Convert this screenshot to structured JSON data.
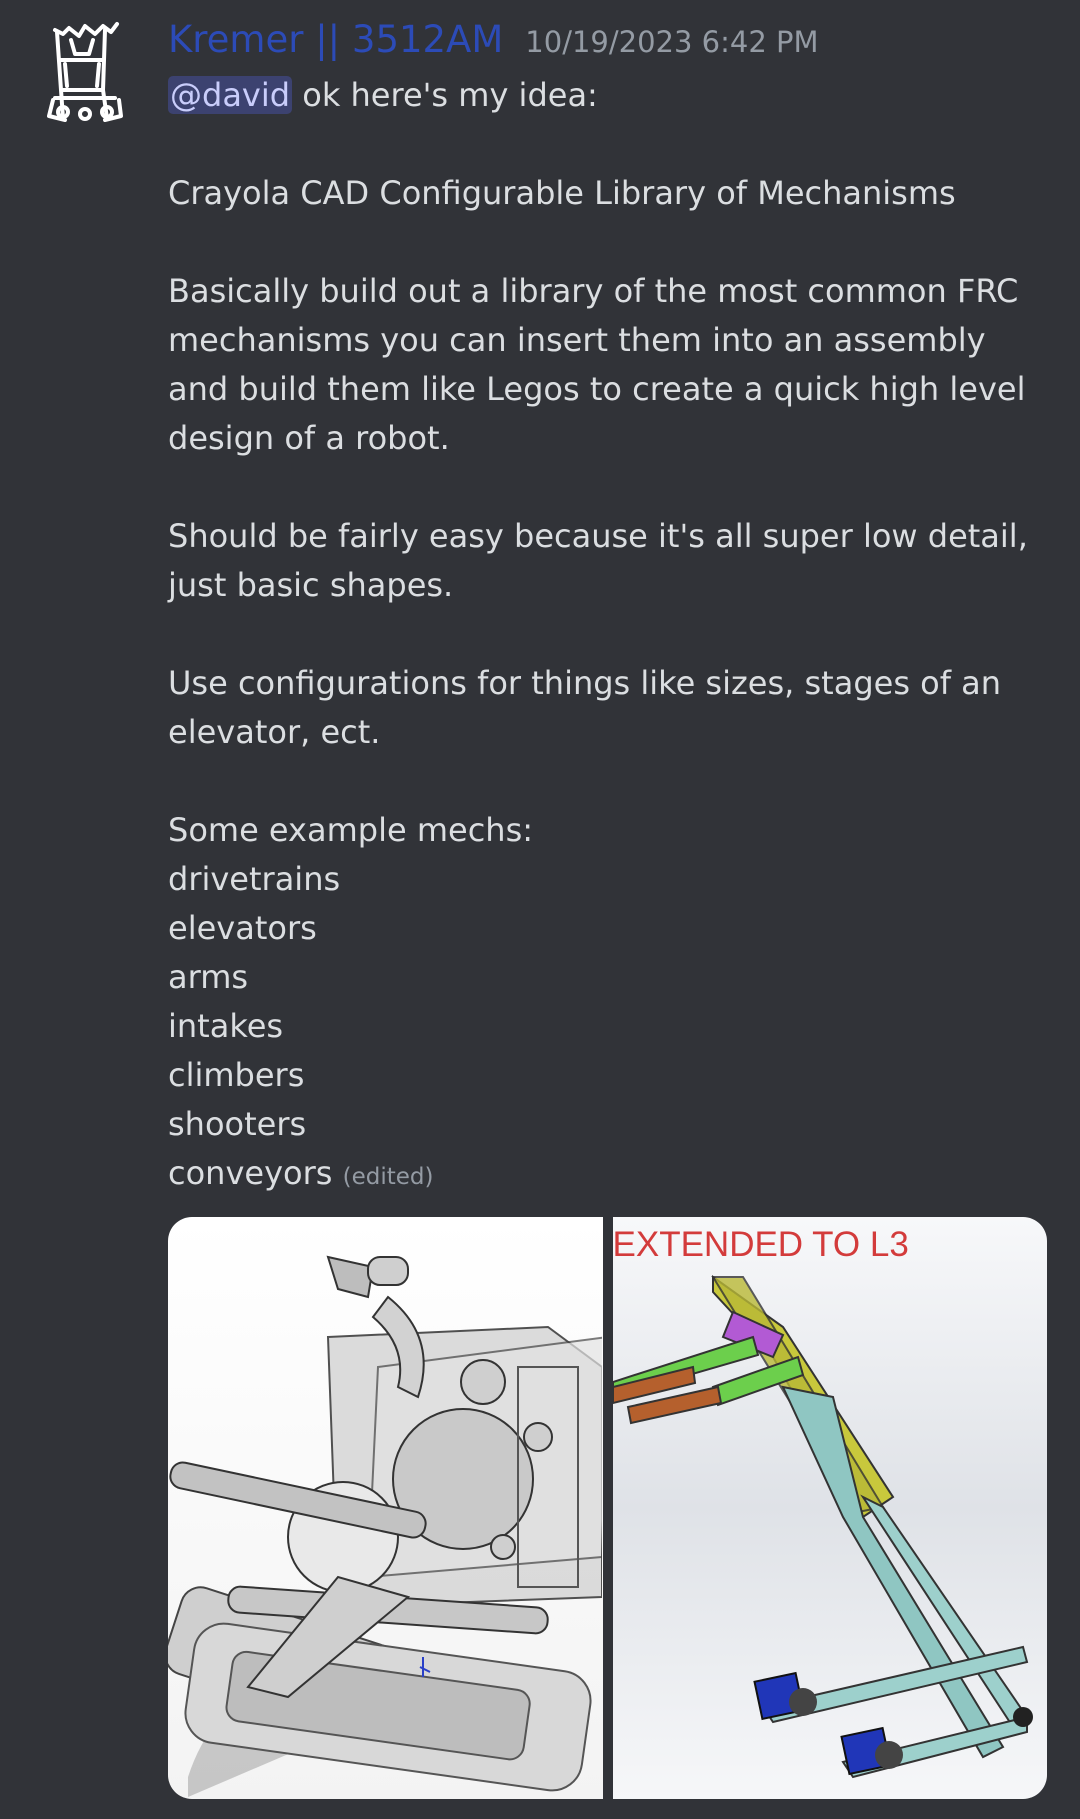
{
  "message": {
    "author": "Kremer || 3512AM",
    "timestamp": "10/19/2023 6:42 PM",
    "mention": "@david",
    "first_line_rest": " ok here's my idea:",
    "title_line": "Crayola CAD Configurable Library of Mechanisms",
    "paragraph_1": "Basically build out a library of the most common FRC mechanisms you can insert them into an assembly and build them like Legos to create a quick high level design of a robot.",
    "paragraph_2": "Should be fairly easy because it's all super low detail, just basic shapes.",
    "paragraph_3": "Use configurations for things like sizes, stages of an elevator, ect.",
    "list_intro": "Some example mechs:",
    "mechs": [
      "drivetrains",
      "elevators",
      "arms",
      "intakes",
      "climbers",
      "shooters"
    ],
    "last_mech": "conveyors",
    "edited_label": "(edited)"
  },
  "attachments": {
    "image_2_caption": "EXTENDED TO L3"
  },
  "colors": {
    "background": "#313338",
    "author": "#2c4bb7",
    "timestamp": "#949ba4",
    "mention_bg": "#3c4270",
    "caption": "#d33b3b"
  },
  "icons": {
    "avatar": "robot-line-drawing-icon"
  }
}
